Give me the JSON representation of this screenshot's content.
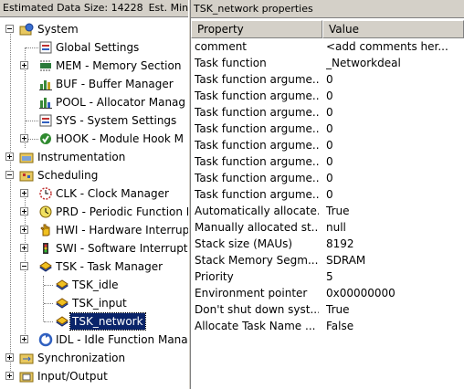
{
  "left_header": {
    "data_size": "Estimated Data Size: 14228",
    "min_stack": "Est. Min. Sta"
  },
  "tree": {
    "system": "System",
    "global_settings": "Global Settings",
    "mem": "MEM - Memory Section",
    "buf": "BUF - Buffer Manager",
    "pool": "POOL - Allocator Manag",
    "sys": "SYS - System Settings",
    "hook": "HOOK - Module Hook M",
    "instrumentation": "Instrumentation",
    "scheduling": "Scheduling",
    "clk": "CLK - Clock Manager",
    "prd": "PRD - Periodic Function I",
    "hwi": "HWI - Hardware Interrup",
    "swi": "SWI - Software Interrupt",
    "tsk": "TSK - Task Manager",
    "tsk_idle": "TSK_idle",
    "tsk_input": "TSK_input",
    "tsk_network": "TSK_network",
    "idl": "IDL - Idle Function Mana",
    "synchronization": "Synchronization",
    "io": "Input/Output"
  },
  "properties": {
    "title": "TSK_network properties",
    "col_property": "Property",
    "col_value": "Value",
    "rows": [
      {
        "name": "comment",
        "value": "<add comments her..."
      },
      {
        "name": "Task function",
        "value": "_Networkdeal"
      },
      {
        "name": "Task function argume...",
        "value": "0"
      },
      {
        "name": "Task function argume...",
        "value": "0"
      },
      {
        "name": "Task function argume...",
        "value": "0"
      },
      {
        "name": "Task function argume...",
        "value": "0"
      },
      {
        "name": "Task function argume...",
        "value": "0"
      },
      {
        "name": "Task function argume...",
        "value": "0"
      },
      {
        "name": "Task function argume...",
        "value": "0"
      },
      {
        "name": "Task function argume...",
        "value": "0"
      },
      {
        "name": "Automatically allocate...",
        "value": "True"
      },
      {
        "name": "Manually allocated st...",
        "value": "null"
      },
      {
        "name": "Stack size (MAUs)",
        "value": "8192"
      },
      {
        "name": "Stack Memory Segm...",
        "value": "SDRAM"
      },
      {
        "name": "Priority",
        "value": "5"
      },
      {
        "name": "Environment pointer",
        "value": "0x00000000"
      },
      {
        "name": "Don't shut down syst...",
        "value": "True"
      },
      {
        "name": "Allocate Task Name ...",
        "value": "False"
      }
    ]
  },
  "colors": {
    "selection": "#0a246a",
    "panel": "#d4d0c8"
  }
}
